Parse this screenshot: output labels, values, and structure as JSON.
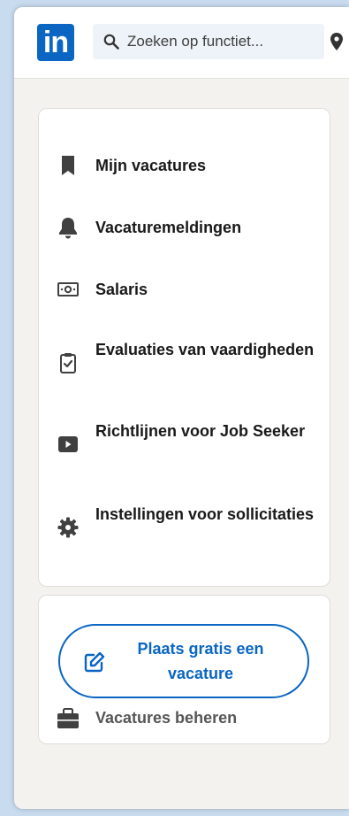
{
  "header": {
    "logo_text": "in",
    "search_placeholder": "Zoeken op functiet..."
  },
  "sidebar": {
    "items": [
      {
        "label": "Mijn vacatures",
        "icon": "bookmark-icon"
      },
      {
        "label": "Vacaturemeldingen",
        "icon": "bell-icon"
      },
      {
        "label": "Salaris",
        "icon": "money-icon"
      },
      {
        "label": "Evaluaties van vaardigheden",
        "icon": "clipboard-check-icon"
      },
      {
        "label": "Richtlijnen voor Job Seeker",
        "icon": "video-play-icon"
      },
      {
        "label": "Instellingen voor sollicitaties",
        "icon": "gear-icon"
      }
    ]
  },
  "actions": {
    "post_job_label": "Plaats gratis een vacature",
    "manage_jobs_label": "Vacatures beheren"
  },
  "colors": {
    "brand": "#0a66c2",
    "background": "#f4f2ee",
    "text": "#191919"
  }
}
